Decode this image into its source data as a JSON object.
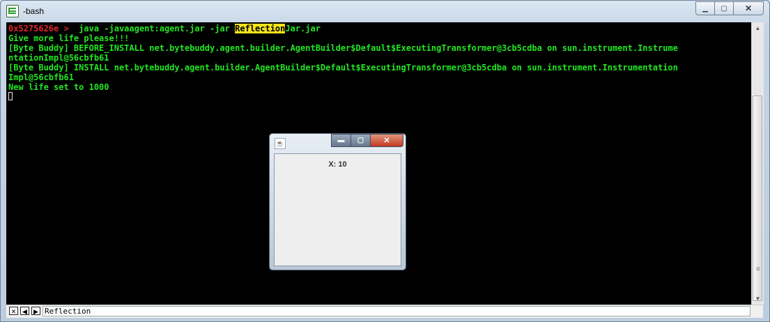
{
  "window": {
    "title": "-bash"
  },
  "window_controls": {
    "minimize": "▁",
    "maximize": "▢",
    "close": "✕"
  },
  "terminal": {
    "prompt": "0x5275626e >",
    "command_pre": "  java -javaagent:agent.jar -jar ",
    "command_highlight": "Reflection",
    "command_post": "Jar.jar",
    "lines": [
      "Give more life please!!!",
      "[Byte Buddy] BEFORE_INSTALL net.bytebuddy.agent.builder.AgentBuilder$Default$ExecutingTransformer@3cb5cdba on sun.instrument.Instrume",
      "ntationImpl@56cbfb61",
      "[Byte Buddy] INSTALL net.bytebuddy.agent.builder.AgentBuilder$Default$ExecutingTransformer@3cb5cdba on sun.instrument.Instrumentation",
      "Impl@56cbfb61",
      "New life set to 1000"
    ]
  },
  "scrollbar": {
    "up": "▲",
    "down": "▼",
    "grip": "≡"
  },
  "statusbar": {
    "close_glyph": "✕",
    "prev_glyph": "◀",
    "next_glyph": "▶",
    "search_value": "Reflection"
  },
  "java_window": {
    "icon_glyph": "☕",
    "minimize": "▬",
    "maximize": "▢",
    "close": "✕",
    "label": "X: 10"
  },
  "colors": {
    "terminal_bg": "#000000",
    "terminal_text": "#22e622",
    "prompt": "#e0262b",
    "highlight": "#f3e21a"
  }
}
